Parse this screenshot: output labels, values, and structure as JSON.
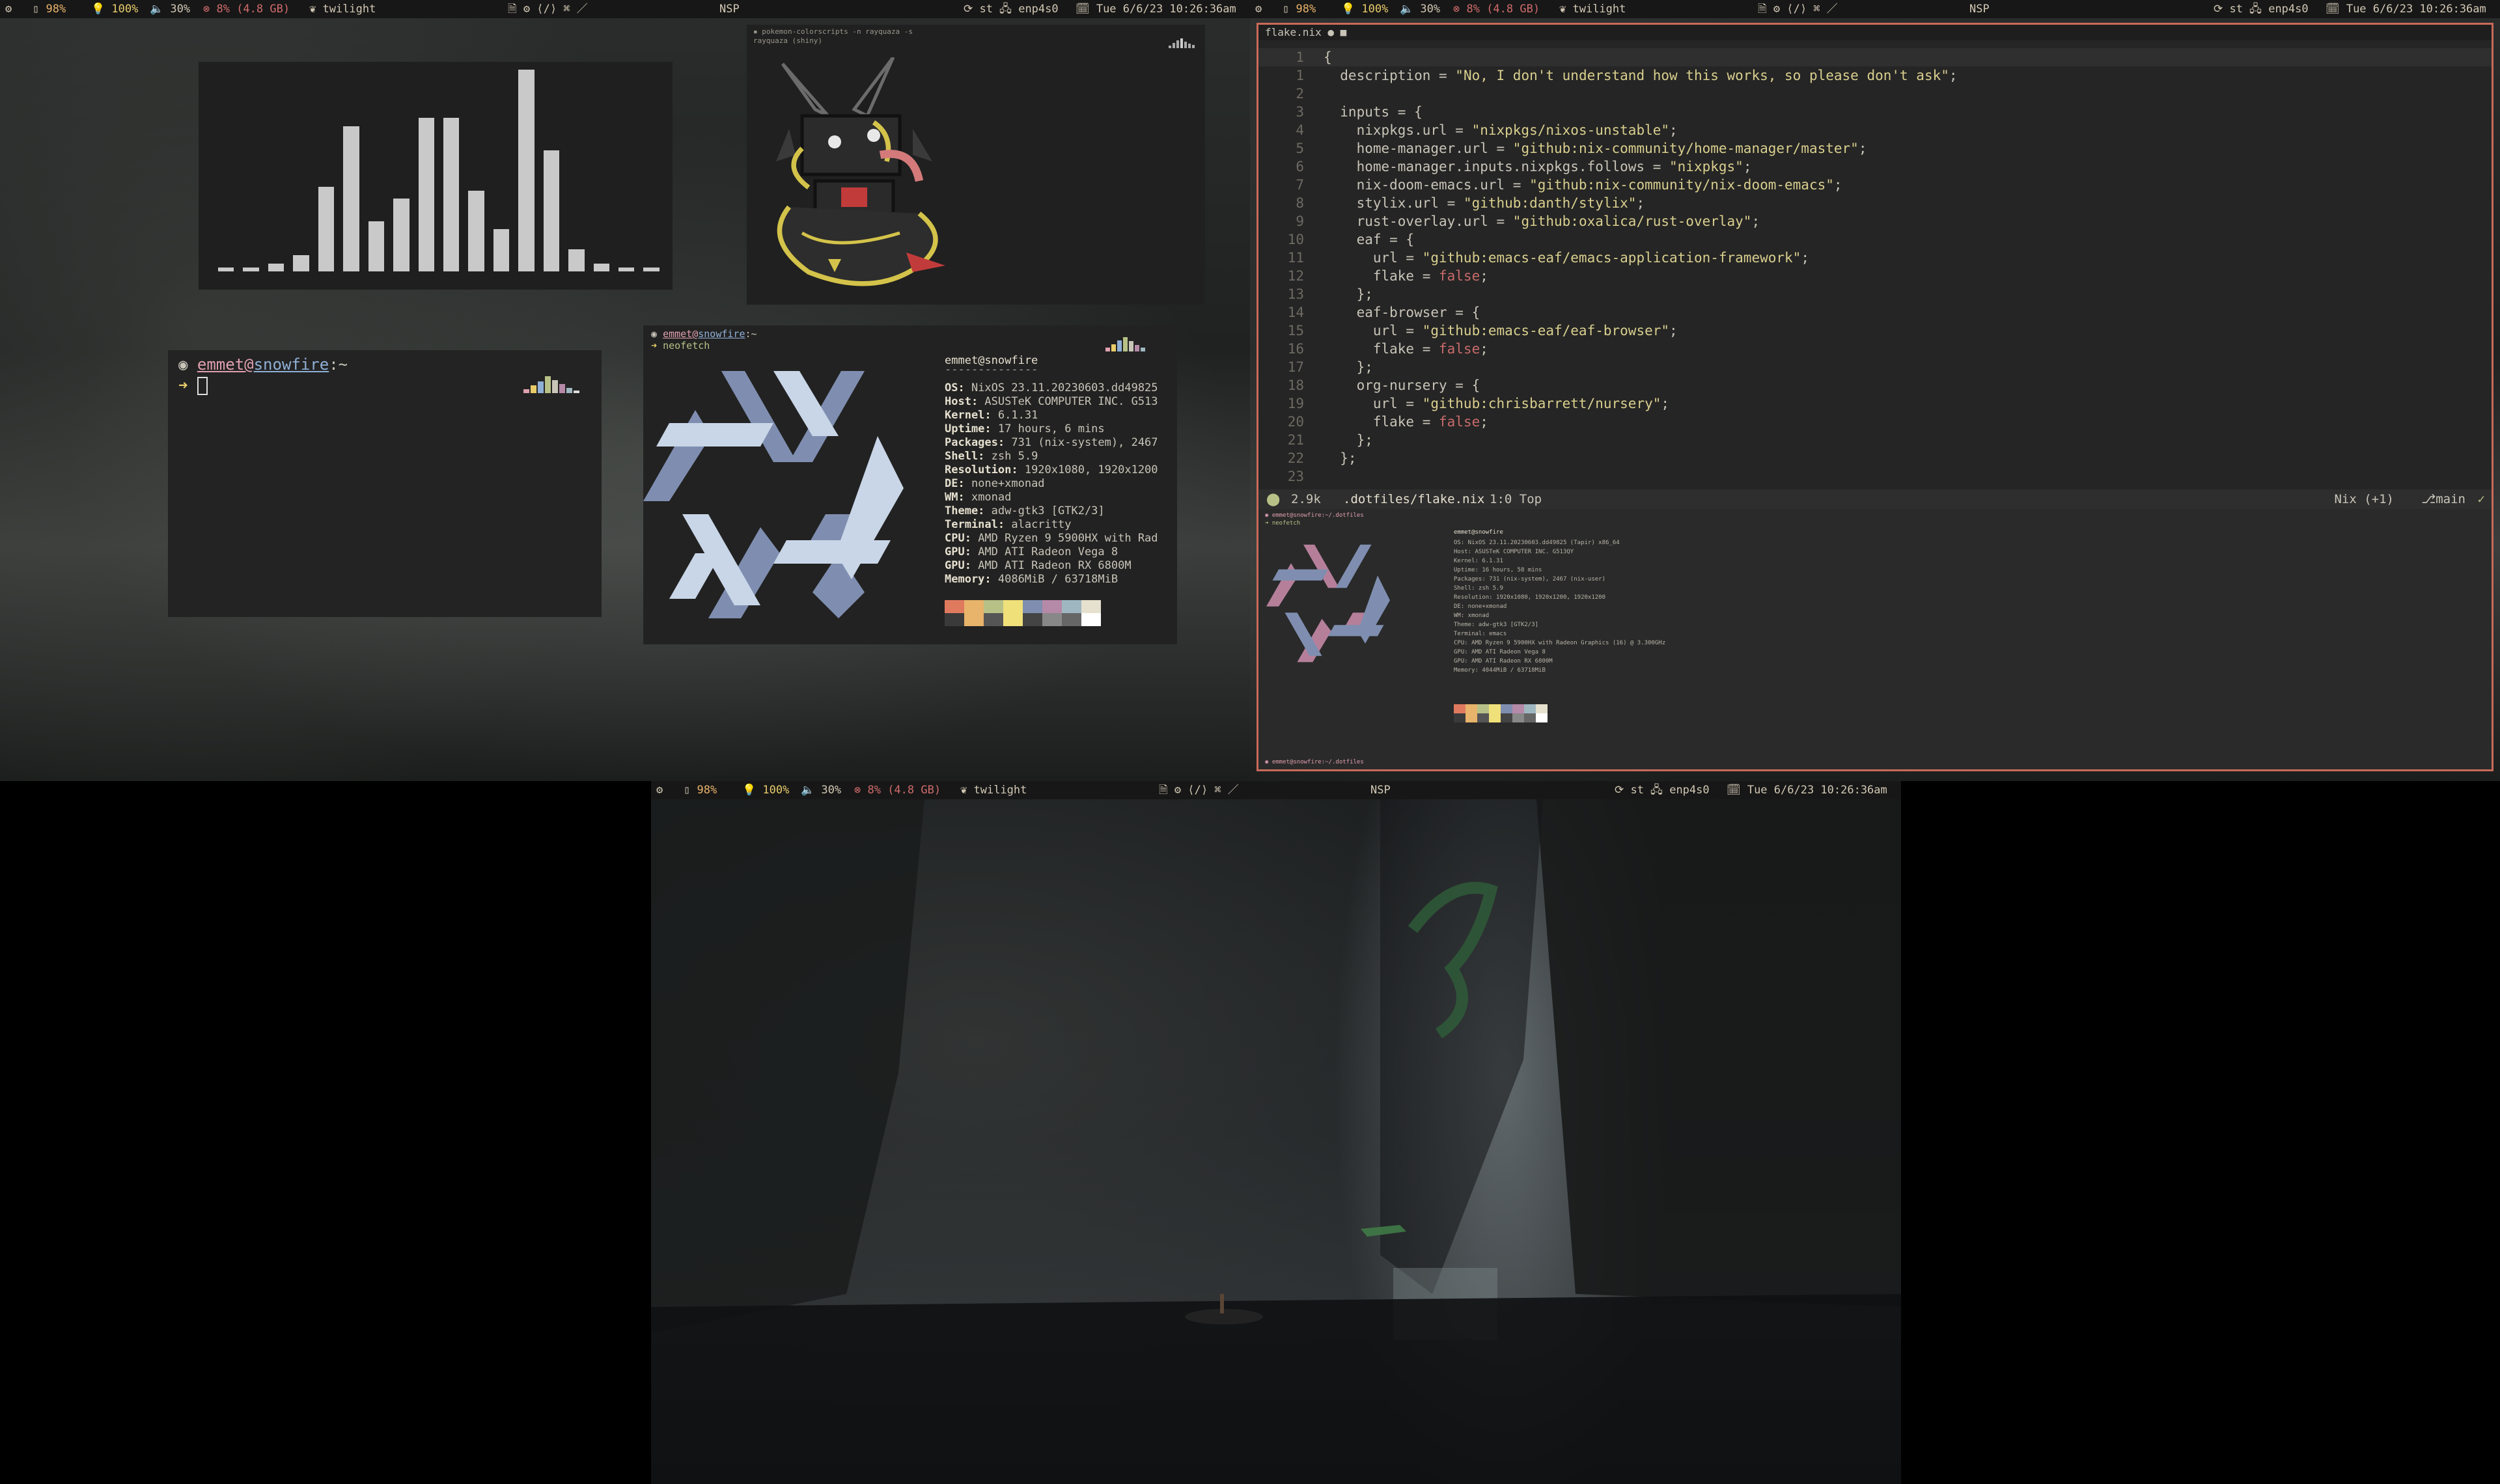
{
  "statusbar": {
    "battery": "98%",
    "brightness": "100%",
    "volume": "30%",
    "memory": "8% (4.8 GB)",
    "theme": "twilight",
    "scratchpad": "NSP",
    "terminal": "st",
    "network": "enp4s0",
    "datetime": "Tue 6/6/23 10:26:36am",
    "workspaces": [
      "①",
      "②",
      "③",
      "④"
    ]
  },
  "cava_window": {
    "levels": [
      0.02,
      0.02,
      0.04,
      0.08,
      0.42,
      0.72,
      0.25,
      0.36,
      0.76,
      0.76,
      0.4,
      0.21,
      1.0,
      0.6,
      0.11,
      0.04,
      0.02,
      0.02
    ]
  },
  "pokemon_window": {
    "prompt": "pokemon-colorscripts -n rayquaza -s",
    "name": "rayquaza (shiny)"
  },
  "shell_window": {
    "user": "emmet",
    "host": "snowfire",
    "path": "~",
    "prompt_symbol": "➜"
  },
  "neofetch_window": {
    "title_user": "emmet",
    "title_host": "snowfire",
    "title_path": "~",
    "command": "neofetch",
    "header": "emmet@snowfire",
    "separator": "--------------",
    "info": [
      {
        "k": "OS",
        "v": "NixOS 23.11.20230603.dd49825"
      },
      {
        "k": "Host",
        "v": "ASUSTeK COMPUTER INC. G513"
      },
      {
        "k": "Kernel",
        "v": "6.1.31"
      },
      {
        "k": "Uptime",
        "v": "17 hours, 6 mins"
      },
      {
        "k": "Packages",
        "v": "731 (nix-system), 2467"
      },
      {
        "k": "Shell",
        "v": "zsh 5.9"
      },
      {
        "k": "Resolution",
        "v": "1920x1080, 1920x1200"
      },
      {
        "k": "DE",
        "v": "none+xmonad"
      },
      {
        "k": "WM",
        "v": "xmonad"
      },
      {
        "k": "Theme",
        "v": "adw-gtk3 [GTK2/3]"
      },
      {
        "k": "Terminal",
        "v": "alacritty"
      },
      {
        "k": "CPU",
        "v": "AMD Ryzen 9 5900HX with Rad"
      },
      {
        "k": "GPU",
        "v": "AMD ATI Radeon Vega 8"
      },
      {
        "k": "GPU",
        "v": "AMD ATI Radeon RX 6800M"
      },
      {
        "k": "Memory",
        "v": "4086MiB / 63718MiB"
      }
    ],
    "palette": [
      "#e07a5f",
      "#e8b36a",
      "#b7c187",
      "#f0e07a",
      "#7f8eb0",
      "#b589a8",
      "#9fb7c0",
      "#e6e0cf"
    ],
    "palette_dark": [
      "#3a3a3a",
      "#e8b36a",
      "#555",
      "#f0e07a",
      "#444",
      "#888",
      "#666",
      "#fff"
    ]
  },
  "emacs_window": {
    "tab": "flake.nix",
    "file_name": ".dotfiles/flake.nix",
    "file_size": "2.9k",
    "position": "1:0 Top",
    "mode": "Nix (+1)",
    "branch": "main",
    "code": [
      {
        "n": "1",
        "t": "{"
      },
      {
        "n": "1",
        "t": "  description = \"No, I don't understand how this works, so please don't ask\";"
      },
      {
        "n": "2",
        "t": ""
      },
      {
        "n": "3",
        "t": "  inputs = {"
      },
      {
        "n": "4",
        "t": "    nixpkgs.url = \"nixpkgs/nixos-unstable\";"
      },
      {
        "n": "5",
        "t": "    home-manager.url = \"github:nix-community/home-manager/master\";"
      },
      {
        "n": "6",
        "t": "    home-manager.inputs.nixpkgs.follows = \"nixpkgs\";"
      },
      {
        "n": "7",
        "t": "    nix-doom-emacs.url = \"github:nix-community/nix-doom-emacs\";"
      },
      {
        "n": "8",
        "t": "    stylix.url = \"github:danth/stylix\";"
      },
      {
        "n": "9",
        "t": "    rust-overlay.url = \"github:oxalica/rust-overlay\";"
      },
      {
        "n": "10",
        "t": "    eaf = {"
      },
      {
        "n": "11",
        "t": "      url = \"github:emacs-eaf/emacs-application-framework\";"
      },
      {
        "n": "12",
        "t": "      flake = false;"
      },
      {
        "n": "13",
        "t": "    };"
      },
      {
        "n": "14",
        "t": "    eaf-browser = {"
      },
      {
        "n": "15",
        "t": "      url = \"github:emacs-eaf/eaf-browser\";"
      },
      {
        "n": "16",
        "t": "      flake = false;"
      },
      {
        "n": "17",
        "t": "    };"
      },
      {
        "n": "18",
        "t": "    org-nursery = {"
      },
      {
        "n": "19",
        "t": "      url = \"github:chrisbarrett/nursery\";"
      },
      {
        "n": "20",
        "t": "      flake = false;"
      },
      {
        "n": "21",
        "t": "    };"
      },
      {
        "n": "22",
        "t": "  };"
      },
      {
        "n": "23",
        "t": ""
      }
    ]
  },
  "embedded_term": {
    "path": "~/.dotfiles",
    "command": "neofetch",
    "header": "emmet@snowfire",
    "lines": [
      "OS: NixOS 23.11.20230603.dd49825 (Tapir) x86_64",
      "Host: ASUSTeK COMPUTER INC. G513QY",
      "Kernel: 6.1.31",
      "Uptime: 16 hours, 58 mins",
      "Packages: 731 (nix-system), 2467 (nix-user)",
      "Shell: zsh 5.9",
      "Resolution: 1920x1080, 1920x1200, 1920x1200",
      "DE: none+xmonad",
      "WM: xmonad",
      "Theme: adw-gtk3 [GTK2/3]",
      "Terminal: emacs",
      "CPU: AMD Ryzen 9 5900HX with Radeon Graphics (16) @ 3.300GHz",
      "GPU: AMD ATI Radeon Vega 8",
      "GPU: AMD ATI Radeon RX 6800M",
      "Memory: 4044MiB / 63718MiB"
    ]
  }
}
